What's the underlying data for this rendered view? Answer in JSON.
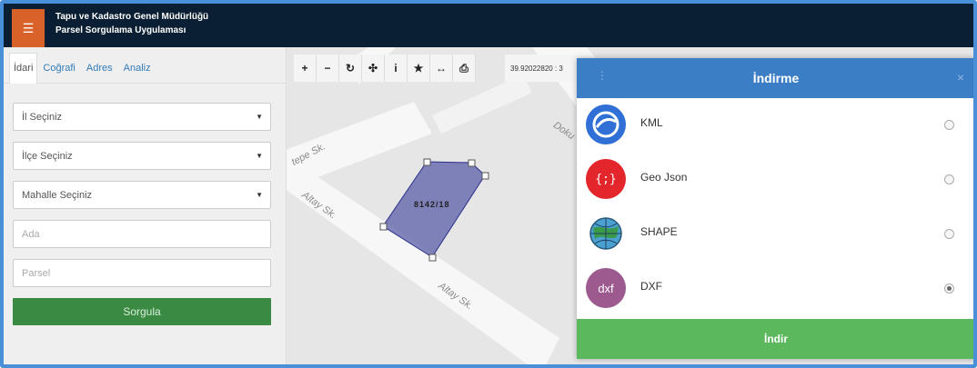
{
  "header": {
    "menu_icon": "hamburger-icon",
    "title_line1": "Tapu ve Kadastro Genel Müdürlüğü",
    "title_line2": "Parsel Sorgulama Uygulaması"
  },
  "sidebar": {
    "tabs": [
      {
        "label": "İdari",
        "active": true
      },
      {
        "label": "Coğrafi"
      },
      {
        "label": "Adres"
      },
      {
        "label": "Analiz"
      }
    ],
    "selects": [
      {
        "value": "İl Seçiniz"
      },
      {
        "value": "İlçe Seçiniz"
      },
      {
        "value": "Mahalle Seçiniz"
      }
    ],
    "inputs": [
      {
        "placeholder": "Ada"
      },
      {
        "placeholder": "Parsel"
      }
    ],
    "submit_label": "Sorgula"
  },
  "map": {
    "toolbar": [
      {
        "icon": "zoom-in-icon",
        "glyph": "+"
      },
      {
        "icon": "zoom-out-icon",
        "glyph": "−"
      },
      {
        "icon": "refresh-icon",
        "glyph": "↻"
      },
      {
        "icon": "locate-icon",
        "glyph": "✣"
      },
      {
        "icon": "info-icon",
        "glyph": "i"
      },
      {
        "icon": "star-icon",
        "glyph": "★"
      },
      {
        "icon": "measure-icon",
        "glyph": "↔"
      },
      {
        "icon": "print-icon",
        "glyph": "⎙"
      }
    ],
    "coordinates": "39.92022820 : 3",
    "streets": {
      "s1": "tepe Sk.",
      "s2": "Altay Sk.",
      "s3": "Altay Sk.",
      "s4": "Doku"
    },
    "parcel_label": "8142/18",
    "parcel_fill": "#5b5fa8"
  },
  "modal": {
    "title": "İndirme",
    "menu_icon": "kebab-icon",
    "close_glyph": "×",
    "options": [
      {
        "label": "KML",
        "icon": "google-earth-icon",
        "glyph": "",
        "color": "#2f6fd6",
        "selected": false
      },
      {
        "label": "Geo Json",
        "icon": "geojson-icon",
        "glyph": "{;}",
        "color": "#e3262b",
        "selected": false
      },
      {
        "label": "SHAPE",
        "icon": "globe-icon",
        "glyph": "",
        "color": "#3a9a4a",
        "selected": false
      },
      {
        "label": "DXF",
        "icon": "dxf-icon",
        "glyph": "dxf",
        "color": "#9c5a8e",
        "selected": true
      }
    ],
    "download_label": "İndir"
  }
}
